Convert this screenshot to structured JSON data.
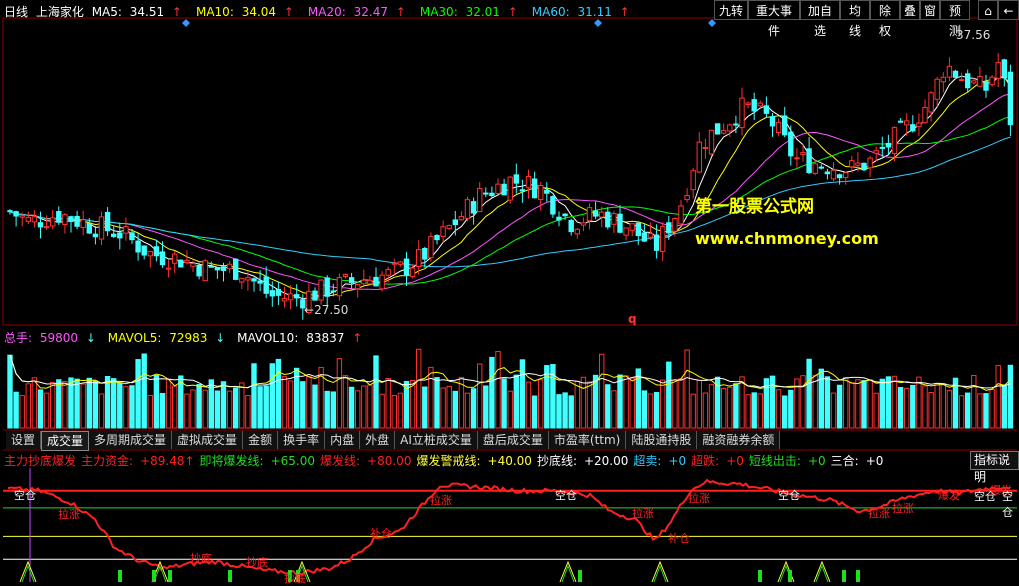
{
  "main_panel": {
    "period": "日线",
    "stock_name": "上海家化",
    "ma": [
      {
        "label": "MA5:",
        "value": "34.51",
        "color": "#ffffff"
      },
      {
        "label": "MA10:",
        "value": "34.04",
        "color": "#ffff00"
      },
      {
        "label": "MA20:",
        "value": "32.47",
        "color": "#ff55ff"
      },
      {
        "label": "MA30:",
        "value": "32.01",
        "color": "#00ff00"
      },
      {
        "label": "MA60:",
        "value": "31.11",
        "color": "#33ccff"
      }
    ],
    "arrow": "↑",
    "high_label": "37.56",
    "low_label": "27.50",
    "q_marker": "q",
    "watermark_title": "第一股票公式网",
    "watermark_url": "www.chnmoney.com"
  },
  "toolbar": [
    "九转",
    "重大事件",
    "加自选",
    "均线",
    "除权",
    "叠",
    "窗",
    "预测"
  ],
  "volume_panel": {
    "total_label": "总手:",
    "total_value": "59800",
    "total_arrow": "↓",
    "mavol5_label": "MAVOL5:",
    "mavol5_value": "72983",
    "mavol5_arrow": "↓",
    "mavol10_label": "MAVOL10:",
    "mavol10_value": "83837",
    "mavol10_arrow": "↑"
  },
  "tabs": [
    "设置",
    "成交量",
    "多周期成交量",
    "虚拟成交量",
    "金额",
    "换手率",
    "内盘",
    "外盘",
    "AI立桩成交量",
    "盘后成交量",
    "市盈率(ttm)",
    "陆股通持股",
    "融资融券余额"
  ],
  "active_tab": "成交量",
  "indicator": {
    "items": [
      {
        "text": "主力抄底爆发",
        "color": "#ff2020"
      },
      {
        "text": "主力资金:",
        "color": "#ff2020"
      },
      {
        "text": "+89.48↑",
        "color": "#ff2020"
      },
      {
        "text": "即将爆发线:",
        "color": "#20dd20"
      },
      {
        "text": "+65.00",
        "color": "#20dd20"
      },
      {
        "text": "爆发线:",
        "color": "#ff2020"
      },
      {
        "text": "+80.00",
        "color": "#ff2020"
      },
      {
        "text": "爆发警戒线:",
        "color": "#ffff40"
      },
      {
        "text": "+40.00",
        "color": "#ffff40"
      },
      {
        "text": "抄底线:",
        "color": "#ffffff"
      },
      {
        "text": "+20.00",
        "color": "#ffffff"
      },
      {
        "text": "超卖:",
        "color": "#33ccff"
      },
      {
        "text": "+0",
        "color": "#33ccff"
      },
      {
        "text": "超跌:",
        "color": "#ff2020"
      },
      {
        "text": "+0",
        "color": "#ff2020"
      },
      {
        "text": "短线出击:",
        "color": "#20dd20"
      },
      {
        "text": "+0",
        "color": "#20dd20"
      },
      {
        "text": "三合:",
        "color": "#ffffff"
      },
      {
        "text": "+0",
        "color": "#ffffff"
      }
    ],
    "help_button": "指标说明",
    "labels": [
      {
        "text": "空仓",
        "color": "#ffffff"
      },
      {
        "text": "拉涨",
        "color": "#ff2020"
      },
      {
        "text": "抄底",
        "color": "#ff2020"
      },
      {
        "text": "抄底",
        "color": "#ff2020"
      },
      {
        "text": "抄底",
        "color": "#ff2020"
      },
      {
        "text": "补仓",
        "color": "#ff2020"
      },
      {
        "text": "拉涨",
        "color": "#ff2020"
      },
      {
        "text": "空仓",
        "color": "#ffffff"
      },
      {
        "text": "拉涨",
        "color": "#ff2020"
      },
      {
        "text": "补仓",
        "color": "#ff2020"
      },
      {
        "text": "拉涨",
        "color": "#ff2020"
      },
      {
        "text": "空仓",
        "color": "#ffffff"
      },
      {
        "text": "拉涨",
        "color": "#ff2020"
      },
      {
        "text": "拉涨",
        "color": "#ff2020"
      },
      {
        "text": "爆发",
        "color": "#ff2020"
      },
      {
        "text": "空仓",
        "color": "#ffffff"
      },
      {
        "text": "爆发",
        "color": "#ff2020"
      },
      {
        "text": "空仓",
        "color": "#ffffff"
      }
    ]
  },
  "colors": {
    "up": "#ff3030",
    "down": "#40ffff",
    "bg": "#000000",
    "grid": "#8b0000"
  }
}
